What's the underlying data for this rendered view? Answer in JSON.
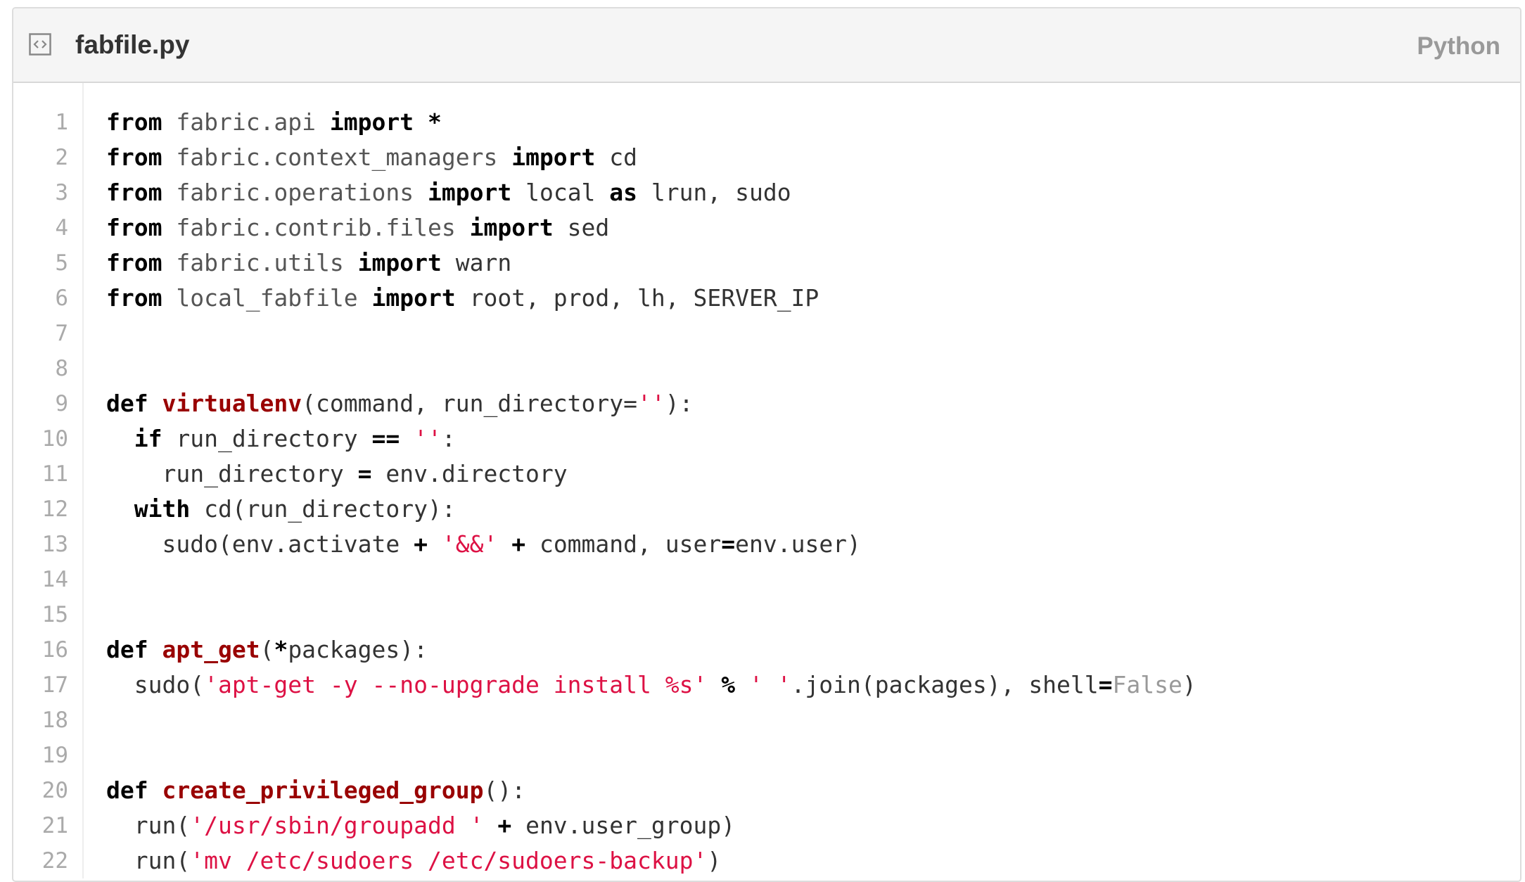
{
  "file": {
    "name": "fabfile.py",
    "language": "Python",
    "icon": "file-code-icon"
  },
  "lines": [
    {
      "n": "1",
      "tokens": [
        {
          "t": "kw",
          "v": "from"
        },
        {
          "t": "",
          "v": " "
        },
        {
          "t": "mod",
          "v": "fabric.api"
        },
        {
          "t": "",
          "v": " "
        },
        {
          "t": "kw",
          "v": "import"
        },
        {
          "t": "",
          "v": " "
        },
        {
          "t": "kw",
          "v": "*"
        }
      ]
    },
    {
      "n": "2",
      "tokens": [
        {
          "t": "kw",
          "v": "from"
        },
        {
          "t": "",
          "v": " "
        },
        {
          "t": "mod",
          "v": "fabric.context_managers"
        },
        {
          "t": "",
          "v": " "
        },
        {
          "t": "kw",
          "v": "import"
        },
        {
          "t": "",
          "v": " cd"
        }
      ]
    },
    {
      "n": "3",
      "tokens": [
        {
          "t": "kw",
          "v": "from"
        },
        {
          "t": "",
          "v": " "
        },
        {
          "t": "mod",
          "v": "fabric.operations"
        },
        {
          "t": "",
          "v": " "
        },
        {
          "t": "kw",
          "v": "import"
        },
        {
          "t": "",
          "v": " local "
        },
        {
          "t": "kw",
          "v": "as"
        },
        {
          "t": "",
          "v": " lrun, sudo"
        }
      ]
    },
    {
      "n": "4",
      "tokens": [
        {
          "t": "kw",
          "v": "from"
        },
        {
          "t": "",
          "v": " "
        },
        {
          "t": "mod",
          "v": "fabric.contrib.files"
        },
        {
          "t": "",
          "v": " "
        },
        {
          "t": "kw",
          "v": "import"
        },
        {
          "t": "",
          "v": " sed"
        }
      ]
    },
    {
      "n": "5",
      "tokens": [
        {
          "t": "kw",
          "v": "from"
        },
        {
          "t": "",
          "v": " "
        },
        {
          "t": "mod",
          "v": "fabric.utils"
        },
        {
          "t": "",
          "v": " "
        },
        {
          "t": "kw",
          "v": "import"
        },
        {
          "t": "",
          "v": " warn"
        }
      ]
    },
    {
      "n": "6",
      "tokens": [
        {
          "t": "kw",
          "v": "from"
        },
        {
          "t": "",
          "v": " "
        },
        {
          "t": "mod",
          "v": "local_fabfile"
        },
        {
          "t": "",
          "v": " "
        },
        {
          "t": "kw",
          "v": "import"
        },
        {
          "t": "",
          "v": " root, prod, lh, SERVER_IP"
        }
      ]
    },
    {
      "n": "7",
      "tokens": []
    },
    {
      "n": "8",
      "tokens": []
    },
    {
      "n": "9",
      "tokens": [
        {
          "t": "kw",
          "v": "def"
        },
        {
          "t": "",
          "v": " "
        },
        {
          "t": "fn",
          "v": "virtualenv"
        },
        {
          "t": "",
          "v": "(command, run_directory="
        },
        {
          "t": "str",
          "v": "''"
        },
        {
          "t": "",
          "v": "):"
        }
      ]
    },
    {
      "n": "10",
      "tokens": [
        {
          "t": "",
          "v": "  "
        },
        {
          "t": "kw",
          "v": "if"
        },
        {
          "t": "",
          "v": " run_directory "
        },
        {
          "t": "kw",
          "v": "=="
        },
        {
          "t": "",
          "v": " "
        },
        {
          "t": "str",
          "v": "''"
        },
        {
          "t": "",
          "v": ":"
        }
      ]
    },
    {
      "n": "11",
      "tokens": [
        {
          "t": "",
          "v": "    run_directory "
        },
        {
          "t": "kw",
          "v": "="
        },
        {
          "t": "",
          "v": " env.directory"
        }
      ]
    },
    {
      "n": "12",
      "tokens": [
        {
          "t": "",
          "v": "  "
        },
        {
          "t": "kw",
          "v": "with"
        },
        {
          "t": "",
          "v": " cd(run_directory):"
        }
      ]
    },
    {
      "n": "13",
      "tokens": [
        {
          "t": "",
          "v": "    sudo(env.activate "
        },
        {
          "t": "kw",
          "v": "+"
        },
        {
          "t": "",
          "v": " "
        },
        {
          "t": "str",
          "v": "'&&'"
        },
        {
          "t": "",
          "v": " "
        },
        {
          "t": "kw",
          "v": "+"
        },
        {
          "t": "",
          "v": " command, user"
        },
        {
          "t": "kw",
          "v": "="
        },
        {
          "t": "",
          "v": "env.user)"
        }
      ]
    },
    {
      "n": "14",
      "tokens": []
    },
    {
      "n": "15",
      "tokens": []
    },
    {
      "n": "16",
      "tokens": [
        {
          "t": "kw",
          "v": "def"
        },
        {
          "t": "",
          "v": " "
        },
        {
          "t": "fn",
          "v": "apt_get"
        },
        {
          "t": "",
          "v": "("
        },
        {
          "t": "kw",
          "v": "*"
        },
        {
          "t": "",
          "v": "packages):"
        }
      ]
    },
    {
      "n": "17",
      "tokens": [
        {
          "t": "",
          "v": "  sudo("
        },
        {
          "t": "str",
          "v": "'apt-get -y --no-upgrade install %s'"
        },
        {
          "t": "",
          "v": " "
        },
        {
          "t": "kw",
          "v": "%"
        },
        {
          "t": "",
          "v": " "
        },
        {
          "t": "str",
          "v": "' '"
        },
        {
          "t": "",
          "v": ".join(packages), shell"
        },
        {
          "t": "kw",
          "v": "="
        },
        {
          "t": "bi",
          "v": "False"
        },
        {
          "t": "",
          "v": ")"
        }
      ]
    },
    {
      "n": "18",
      "tokens": []
    },
    {
      "n": "19",
      "tokens": []
    },
    {
      "n": "20",
      "tokens": [
        {
          "t": "kw",
          "v": "def"
        },
        {
          "t": "",
          "v": " "
        },
        {
          "t": "fn",
          "v": "create_privileged_group"
        },
        {
          "t": "",
          "v": "():"
        }
      ]
    },
    {
      "n": "21",
      "tokens": [
        {
          "t": "",
          "v": "  run("
        },
        {
          "t": "str",
          "v": "'/usr/sbin/groupadd '"
        },
        {
          "t": "",
          "v": " "
        },
        {
          "t": "kw",
          "v": "+"
        },
        {
          "t": "",
          "v": " env.user_group)"
        }
      ]
    },
    {
      "n": "22",
      "tokens": [
        {
          "t": "",
          "v": "  run("
        },
        {
          "t": "str",
          "v": "'mv /etc/sudoers /etc/sudoers-backup'"
        },
        {
          "t": "",
          "v": ")"
        }
      ]
    }
  ]
}
